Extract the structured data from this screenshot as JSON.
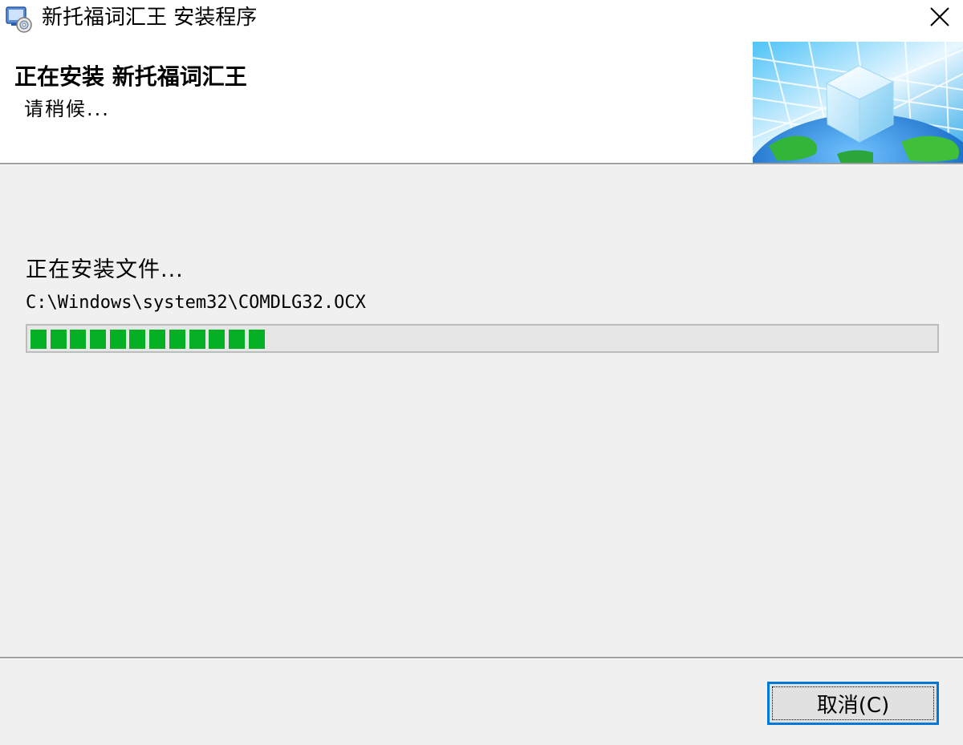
{
  "window": {
    "title": "新托福词汇王 安装程序",
    "app_icon": "installer-disc-icon",
    "close_icon": "close-icon"
  },
  "header": {
    "title": "正在安装 新托福词汇王",
    "subtitle": "请稍候...",
    "banner_image": "globe-cube-banner"
  },
  "main": {
    "status_label": "正在安装文件...",
    "current_file": "C:\\Windows\\system32\\COMDLG32.OCX",
    "progress": {
      "filled_blocks": 12,
      "fraction": 0.26,
      "color": "#06b025"
    }
  },
  "footer": {
    "cancel_label": "取消(C)"
  },
  "colors": {
    "focus_border": "#0078d7",
    "dialog_bg": "#f0f0f0",
    "header_bg": "#ffffff"
  }
}
